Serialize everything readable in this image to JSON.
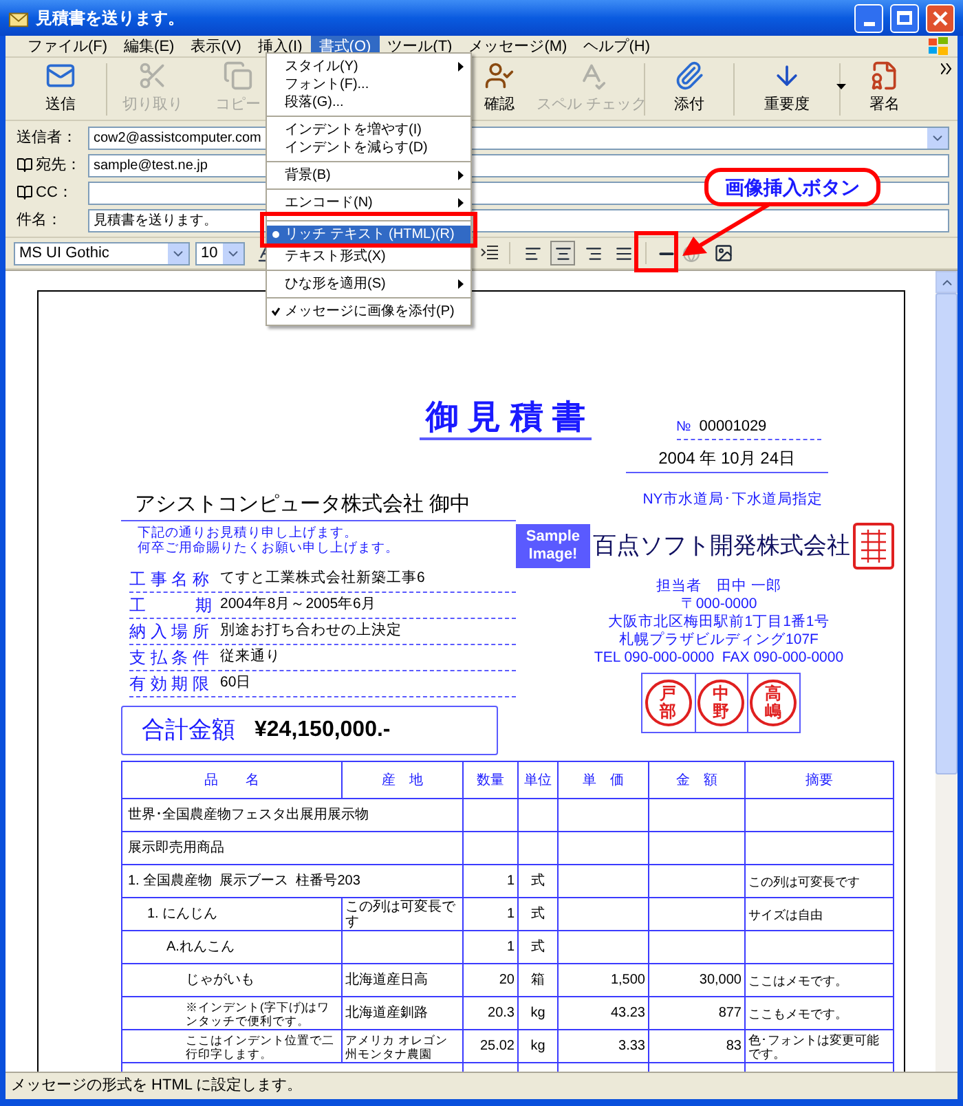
{
  "window": {
    "title": "見積書を送ります。"
  },
  "menu_bar": [
    {
      "label": "ファイル(F)",
      "selected": false
    },
    {
      "label": "編集(E)",
      "selected": false
    },
    {
      "label": "表示(V)",
      "selected": false
    },
    {
      "label": "挿入(I)",
      "selected": false
    },
    {
      "label": "書式(O)",
      "selected": true
    },
    {
      "label": "ツール(T)",
      "selected": false
    },
    {
      "label": "メッセージ(M)",
      "selected": false
    },
    {
      "label": "ヘルプ(H)",
      "selected": false
    }
  ],
  "toolbar": [
    {
      "kind": "send",
      "label": "送信",
      "disabled": false,
      "dropdown": false
    },
    {
      "kind": "cut",
      "label": "切り取り",
      "disabled": true,
      "dropdown": false
    },
    {
      "kind": "copy",
      "label": "コピー",
      "disabled": true,
      "dropdown": false
    },
    {
      "kind": "check",
      "label": "確認",
      "disabled": false,
      "dropdown": false
    },
    {
      "kind": "spell",
      "label": "スペル チェック",
      "disabled": true,
      "dropdown": false
    },
    {
      "kind": "attach",
      "label": "添付",
      "disabled": false,
      "dropdown": false
    },
    {
      "kind": "priority",
      "label": "重要度",
      "disabled": false,
      "dropdown": true
    },
    {
      "kind": "sign",
      "label": "署名",
      "disabled": false,
      "dropdown": false
    }
  ],
  "fields": [
    {
      "kind": "select",
      "label": "送信者：",
      "value": "cow2@assistcomputer.com",
      "address_book": false
    },
    {
      "kind": "text",
      "label": "宛先：",
      "value": "sample@test.ne.jp",
      "address_book": true
    },
    {
      "kind": "text",
      "label": "CC：",
      "address_book": true
    },
    {
      "kind": "text",
      "label": "件名：",
      "value": "見積書を送ります。",
      "address_book": false
    }
  ],
  "format_toolbar": {
    "font": "MS UI Gothic",
    "size": "10",
    "alignment": [
      {
        "kind": "left",
        "selected": false
      },
      {
        "kind": "center",
        "selected": true
      },
      {
        "kind": "right",
        "selected": false
      },
      {
        "kind": "justify",
        "selected": false
      }
    ]
  },
  "format_menu": {
    "items": [
      {
        "label": "スタイル(Y)",
        "kind": "plain",
        "checked": false,
        "submenu": true,
        "selected": false,
        "separator_before": false
      },
      {
        "label": "フォント(F)...",
        "kind": "plain",
        "checked": false,
        "submenu": false,
        "selected": false,
        "separator_before": false
      },
      {
        "label": "段落(G)...",
        "kind": "plain",
        "checked": false,
        "submenu": false,
        "selected": false,
        "separator_before": false
      },
      {
        "label": "インデントを増やす(I)",
        "kind": "plain",
        "checked": false,
        "submenu": false,
        "selected": false,
        "separator_before": true
      },
      {
        "label": "インデントを減らす(D)",
        "kind": "plain",
        "checked": false,
        "submenu": false,
        "selected": false,
        "separator_before": false
      },
      {
        "label": "背景(B)",
        "kind": "plain",
        "checked": false,
        "submenu": true,
        "selected": false,
        "separator_before": true
      },
      {
        "label": "エンコード(N)",
        "kind": "plain",
        "checked": false,
        "submenu": true,
        "selected": false,
        "separator_before": true
      },
      {
        "label": "リッチ テキスト (HTML)(R)",
        "kind": "radio",
        "checked": true,
        "submenu": false,
        "selected": true,
        "separator_before": true
      },
      {
        "label": "テキスト形式(X)",
        "kind": "radio",
        "checked": false,
        "submenu": false,
        "selected": false,
        "separator_before": false
      },
      {
        "label": "ひな形を適用(S)",
        "kind": "plain",
        "checked": false,
        "submenu": true,
        "selected": false,
        "separator_before": true
      },
      {
        "label": "メッセージに画像を添付(P)",
        "kind": "check",
        "checked": true,
        "submenu": false,
        "selected": false,
        "separator_before": true
      }
    ]
  },
  "callout": {
    "text": "画像挿入ボタン"
  },
  "document": {
    "title": "御 見 積 書",
    "number_label": "№",
    "number": "00001029",
    "date": "2004 年 10月 24日",
    "recipient": "アシストコンピュータ株式会社 御中",
    "greeting": [
      "下記の通りお見積り申し上げます。",
      "何卒ご用命賜りたくお願い申し上げます。"
    ],
    "details": [
      {
        "label": "工 事 名 称",
        "value": "てすと工業株式会社新築工事6"
      },
      {
        "label": "工　　　期",
        "value": "2004年8月～2005年6月"
      },
      {
        "label": "納 入 場 所",
        "value": "別途お打ち合わせの上決定"
      },
      {
        "label": "支 払 条 件",
        "value": "従来通り"
      },
      {
        "label": "有 効 期 限",
        "value": "60日"
      }
    ],
    "total": {
      "label": "合計金額",
      "amount": "¥24,150,000.-"
    },
    "designation": "NY市水道局･下水道局指定",
    "sample_badge": "Sample Image!",
    "company": "百点ソフト開発株式会社",
    "contact": [
      "担当者　田中 一郎",
      "〒000-0000",
      "大阪市北区梅田駅前1丁目1番1号",
      "札幌プラザビルディング107F",
      "TEL 090-000-0000  FAX 090-000-0000"
    ],
    "stamps": [
      "戸部",
      "中野",
      "高嶋"
    ],
    "table": {
      "columns": [
        "品　　名",
        "産　地",
        "数量",
        "単位",
        "単　価",
        "金　額",
        "摘要"
      ],
      "rows": [
        {
          "kind": "wide",
          "name": "世界･全国農産物フェスタ出展用展示物"
        },
        {
          "kind": "wide",
          "name": "展示即売用商品"
        },
        {
          "kind": "wide",
          "name": "1. 全国農産物  展示ブース  柱番号203",
          "quantity": "1",
          "unit": "式",
          "note": "この列は可変長です",
          "children": [
            {
              "kind": "item",
              "name": "1. にんじん",
              "origin": "この列は可変長です",
              "quantity": "1",
              "unit": "式",
              "note": "サイズは自由",
              "children": [
                {
                  "kind": "item",
                  "name": "A.れんこん",
                  "quantity": "1",
                  "unit": "式",
                  "children": [
                    {
                      "kind": "item",
                      "name": "じゃがいも",
                      "origin": "北海道産日高",
                      "quantity": "20",
                      "unit": "箱",
                      "unit_price": "1,500",
                      "amount": "30,000",
                      "note": "ここはメモです。"
                    },
                    {
                      "kind": "item",
                      "name": "※インデント(字下げ)はワンタッチで便利です。",
                      "origin": "北海道産釧路",
                      "quantity": "20.3",
                      "unit": "kg",
                      "unit_price": "43.23",
                      "amount": "877",
                      "note": "ここもメモです。"
                    },
                    {
                      "kind": "item",
                      "name": "ここはインデント位置で二行印字します。",
                      "origin": "アメリカ オレゴン州モンタナ農園",
                      "quantity": "25.02",
                      "unit": "kg",
                      "unit_price": "3.33",
                      "amount": "83",
                      "note": "色･フォントは変更可能です。"
                    }
                  ]
                }
              ]
            }
          ]
        }
      ]
    }
  },
  "status_bar": "メッセージの形式を HTML に設定します。"
}
